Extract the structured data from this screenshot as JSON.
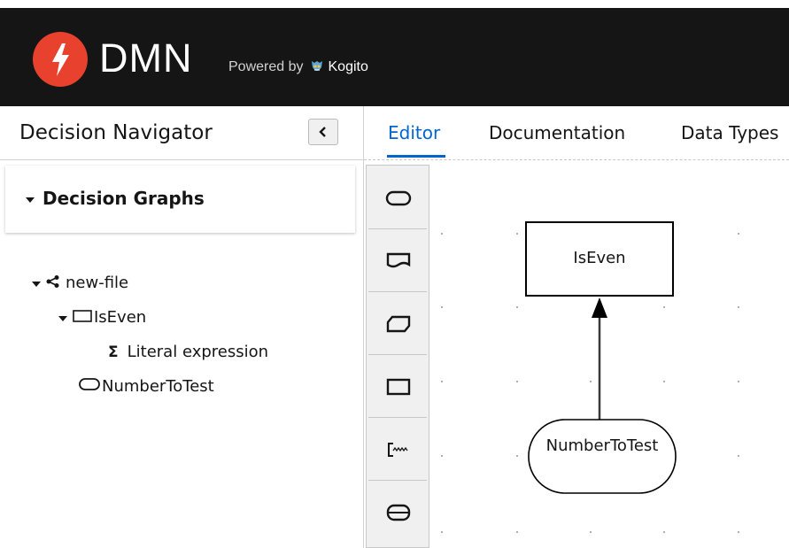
{
  "header": {
    "app_title": "DMN",
    "powered_by": "Powered by",
    "kogito_label": "Kogito",
    "background_color": "#151515",
    "logo_color": "#e8412e",
    "logo_icon": "lightning-bolt-icon"
  },
  "navigator": {
    "title": "Decision Navigator",
    "collapse_icon": "chevron-left-icon",
    "section_title": "Decision Graphs",
    "tree": [
      {
        "label": "new-file",
        "icon": "share-nodes-icon"
      },
      {
        "label": "IsEven",
        "icon": "decision-rectangle-icon"
      },
      {
        "label": "Literal expression",
        "icon": "sigma-icon"
      },
      {
        "label": "NumberToTest",
        "icon": "input-data-icon"
      }
    ]
  },
  "tabs": [
    {
      "label": "Editor",
      "active": true
    },
    {
      "label": "Documentation",
      "active": false
    },
    {
      "label": "Data Types",
      "active": false
    }
  ],
  "accent_color": "#0066cc",
  "palette": [
    {
      "name": "input-data-tool",
      "icon": "rounded-rectangle-icon"
    },
    {
      "name": "knowledge-source-tool",
      "icon": "wavy-document-icon"
    },
    {
      "name": "bkm-tool",
      "icon": "cut-corner-rectangle-icon"
    },
    {
      "name": "decision-tool",
      "icon": "rectangle-icon"
    },
    {
      "name": "text-annotation-tool",
      "icon": "bracket-text-icon"
    },
    {
      "name": "decision-service-tool",
      "icon": "split-rounded-rectangle-icon"
    }
  ],
  "canvas": {
    "nodes": [
      {
        "label": "IsEven",
        "type": "decision"
      },
      {
        "label": "NumberToTest",
        "type": "input-data"
      }
    ],
    "edge": {
      "from": "NumberToTest",
      "to": "IsEven",
      "type": "information-requirement"
    }
  }
}
